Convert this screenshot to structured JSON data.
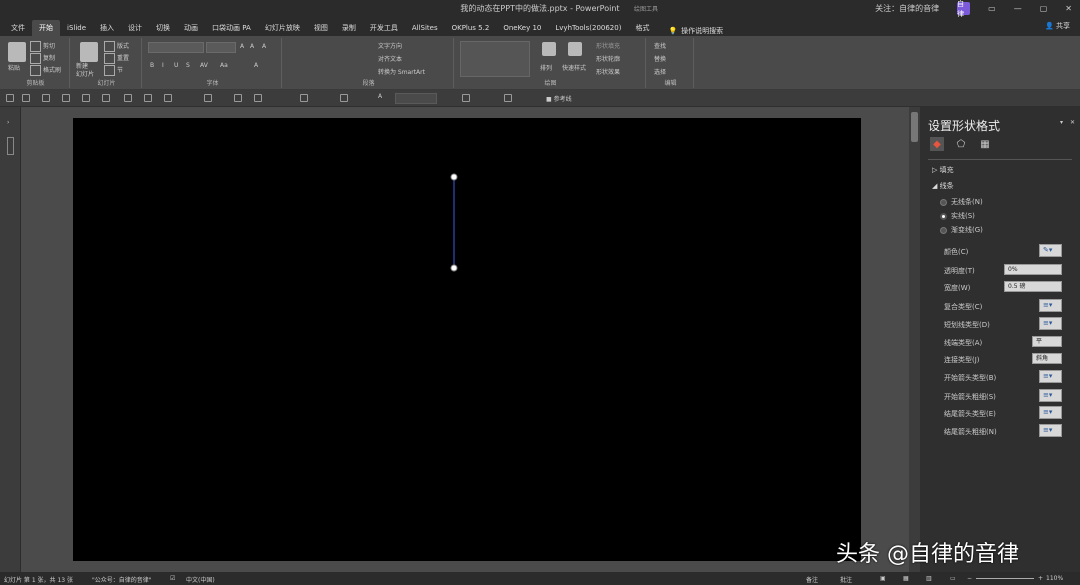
{
  "titlebar": {
    "title": "我的动态在PPT中的做法.pptx - PowerPoint",
    "context_tab": "绘图工具",
    "account": "关注：自律的音律",
    "avatar": "自律",
    "min": "—",
    "restore": "▢",
    "close": "✕",
    "ribbon_toggle": "▭"
  },
  "tabs": [
    "文件",
    "开始",
    "iSlide",
    "插入",
    "设计",
    "切换",
    "动画",
    "口袋动画 PA",
    "幻灯片放映",
    "视图",
    "录制",
    "开发工具",
    "AllSites",
    "OKPlus 5.2",
    "OneKey 10",
    "LvyhTools(200620)",
    "格式"
  ],
  "tell_me": "操作说明搜索",
  "share": "共享",
  "ribbon": {
    "clipboard": {
      "label": "剪贴板",
      "paste": "粘贴",
      "cut": "剪切",
      "copy": "复制",
      "painter": "格式刷"
    },
    "slides": {
      "label": "幻灯片",
      "new": "新建\n幻灯片",
      "layout": "版式",
      "reset": "重置",
      "section": "节"
    },
    "font": {
      "label": "字体",
      "bold": "B",
      "italic": "I",
      "underline": "U",
      "strike": "S",
      "spacing": "AV",
      "case": "Aa",
      "size_up": "A",
      "size_down": "A",
      "clear": "A",
      "color": "A"
    },
    "paragraph": {
      "label": "段落",
      "direction": "文字方向",
      "align": "对齐文本",
      "smartart": "转换为 SmartArt"
    },
    "drawing": {
      "label": "绘图",
      "arrange": "排列",
      "quick": "快速样式",
      "fill": "形状填充",
      "outline": "形状轮廓",
      "effect": "形状效果"
    },
    "editing": {
      "label": "编辑",
      "find": "查找",
      "replace": "替换",
      "select": "选择"
    }
  },
  "qat": {
    "font_color": "A",
    "zoom_marker": "参考线"
  },
  "pane": {
    "title": "设置形状格式",
    "close": "✕",
    "sections": {
      "fill": "填充",
      "line": "线条"
    },
    "line_options": [
      {
        "label": "无线条(N)",
        "selected": false
      },
      {
        "label": "实线(S)",
        "selected": true
      },
      {
        "label": "渐变线(G)",
        "selected": false
      }
    ],
    "props": [
      {
        "label": "颜色(C)",
        "value": ""
      },
      {
        "label": "透明度(T)",
        "value": "0%"
      },
      {
        "label": "宽度(W)",
        "value": "0.5 磅"
      },
      {
        "label": "复合类型(C)",
        "value": ""
      },
      {
        "label": "短划线类型(D)",
        "value": ""
      },
      {
        "label": "线端类型(A)",
        "value": "平"
      },
      {
        "label": "连接类型(J)",
        "value": "斜角"
      },
      {
        "label": "开始箭头类型(B)",
        "value": ""
      },
      {
        "label": "开始箭头粗细(S)",
        "value": ""
      },
      {
        "label": "结尾箭头类型(E)",
        "value": ""
      },
      {
        "label": "结尾箭头粗细(N)",
        "value": ""
      }
    ]
  },
  "statusbar": {
    "slide": "幻灯片 第 1 张，共 13 张",
    "theme": "\"公众号：自律的音律\"",
    "lang": "中文(中国)",
    "notes": "备注",
    "comments": "批注",
    "zoom": "110%"
  },
  "watermark": "头条 @自律的音律",
  "colors": {
    "slide_bg": "#000000",
    "line": "#3b5bdb",
    "ribbon": "#4a4a4a",
    "pane": "#2f2f2f"
  }
}
